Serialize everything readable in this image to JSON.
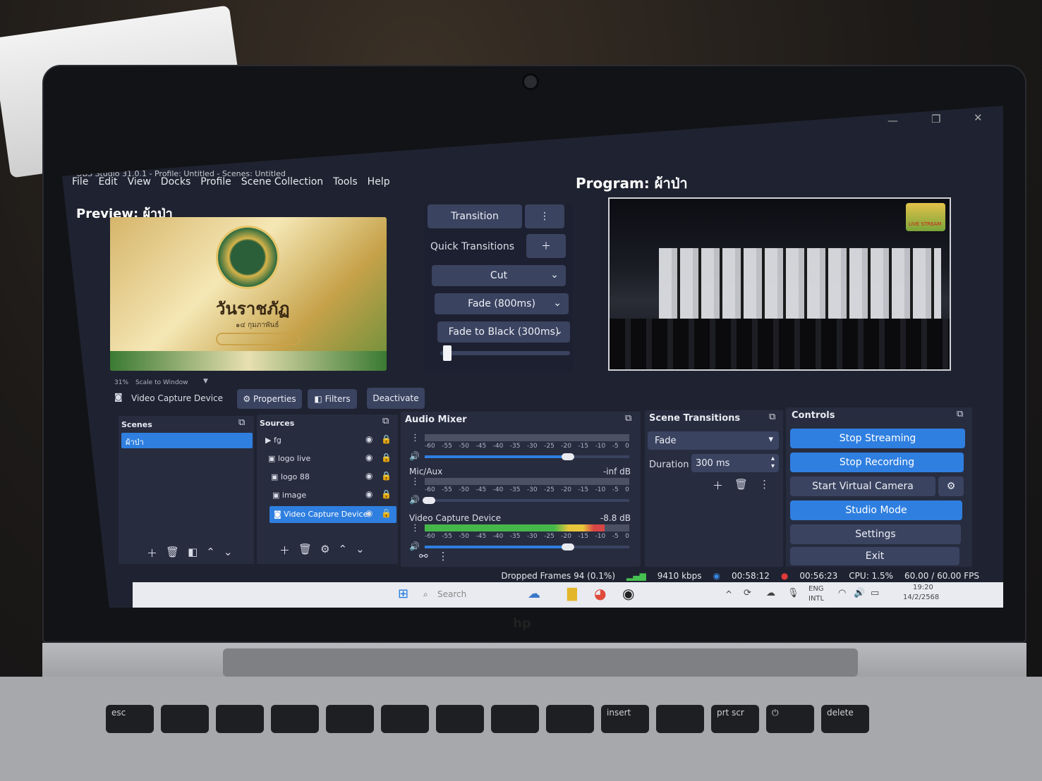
{
  "window": {
    "title": "OBS Studio 31.0.1 - Profile: Untitled - Scenes: Untitled",
    "controls": [
      "—",
      "❐",
      "✕"
    ]
  },
  "menu": [
    "File",
    "Edit",
    "View",
    "Docks",
    "Profile",
    "Scene Collection",
    "Tools",
    "Help"
  ],
  "preview": {
    "label": "Preview: ผ้าป่า",
    "image_text": "วันราชภัฏ",
    "image_sub": "๑๔ กุมภาพันธ์",
    "scale_pct": "31%",
    "scale_mode": "Scale to Window"
  },
  "program": {
    "label": "Program: ผ้าป่า",
    "badge": "LIVE STREAM"
  },
  "transition_panel": {
    "transition_label": "Transition",
    "quick_label": "Quick Transitions",
    "items": [
      "Cut",
      "Fade (800ms)",
      "Fade to Black (300ms)"
    ],
    "tbar_level": 0.02
  },
  "source_toolbar": {
    "selected": "Video Capture Device",
    "properties": "Properties",
    "filters": "Filters",
    "deactivate": "Deactivate"
  },
  "scenes": {
    "title": "Scenes",
    "items": [
      "ผ้าป่า"
    ]
  },
  "sources": {
    "title": "Sources",
    "items": [
      "fg",
      "logo live",
      "logo 88",
      "image",
      "Video Capture Device"
    ]
  },
  "audio_mixer": {
    "title": "Audio Mixer",
    "scale": [
      "-60",
      "-55",
      "-50",
      "-45",
      "-40",
      "-35",
      "-30",
      "-25",
      "-20",
      "-15",
      "-10",
      "-5",
      "0"
    ],
    "channels": [
      {
        "name": "",
        "level": "",
        "meter": 0.0,
        "volume": 0.7
      },
      {
        "name": "Mic/Aux",
        "level": "-inf dB",
        "meter": 0.0,
        "volume": 0.02
      },
      {
        "name": "Video Capture Device",
        "level": "-8.8 dB",
        "meter": 0.88,
        "volume": 0.7
      }
    ]
  },
  "scene_transitions": {
    "title": "Scene Transitions",
    "type": "Fade",
    "duration_label": "Duration",
    "duration_value": "300 ms"
  },
  "controls": {
    "title": "Controls",
    "buttons": [
      "Stop Streaming",
      "Stop Recording",
      "Start Virtual Camera",
      "Studio Mode",
      "Settings",
      "Exit"
    ]
  },
  "status": {
    "dropped": "Dropped Frames 94 (0.1%)",
    "bitrate": "9410 kbps",
    "stream_time": "00:58:12",
    "rec_time": "00:56:23",
    "cpu": "CPU: 1.5%",
    "fps": "60.00 / 60.00 FPS"
  },
  "taskbar": {
    "search": "Search",
    "lang": "ENG",
    "lang2": "INTL",
    "time": "19:20",
    "date": "14/2/2568"
  },
  "keyboard": {
    "row1": [
      "esc",
      "",
      "",
      "",
      "",
      "",
      "",
      "",
      "",
      "",
      "insert",
      "",
      "",
      "prt scr",
      "",
      "delete"
    ]
  },
  "brand": "hp",
  "colors": {
    "accent": "#2f7fe0",
    "dock": "#272c3f",
    "bg": "#1f2230",
    "record": "#e03a3a"
  }
}
